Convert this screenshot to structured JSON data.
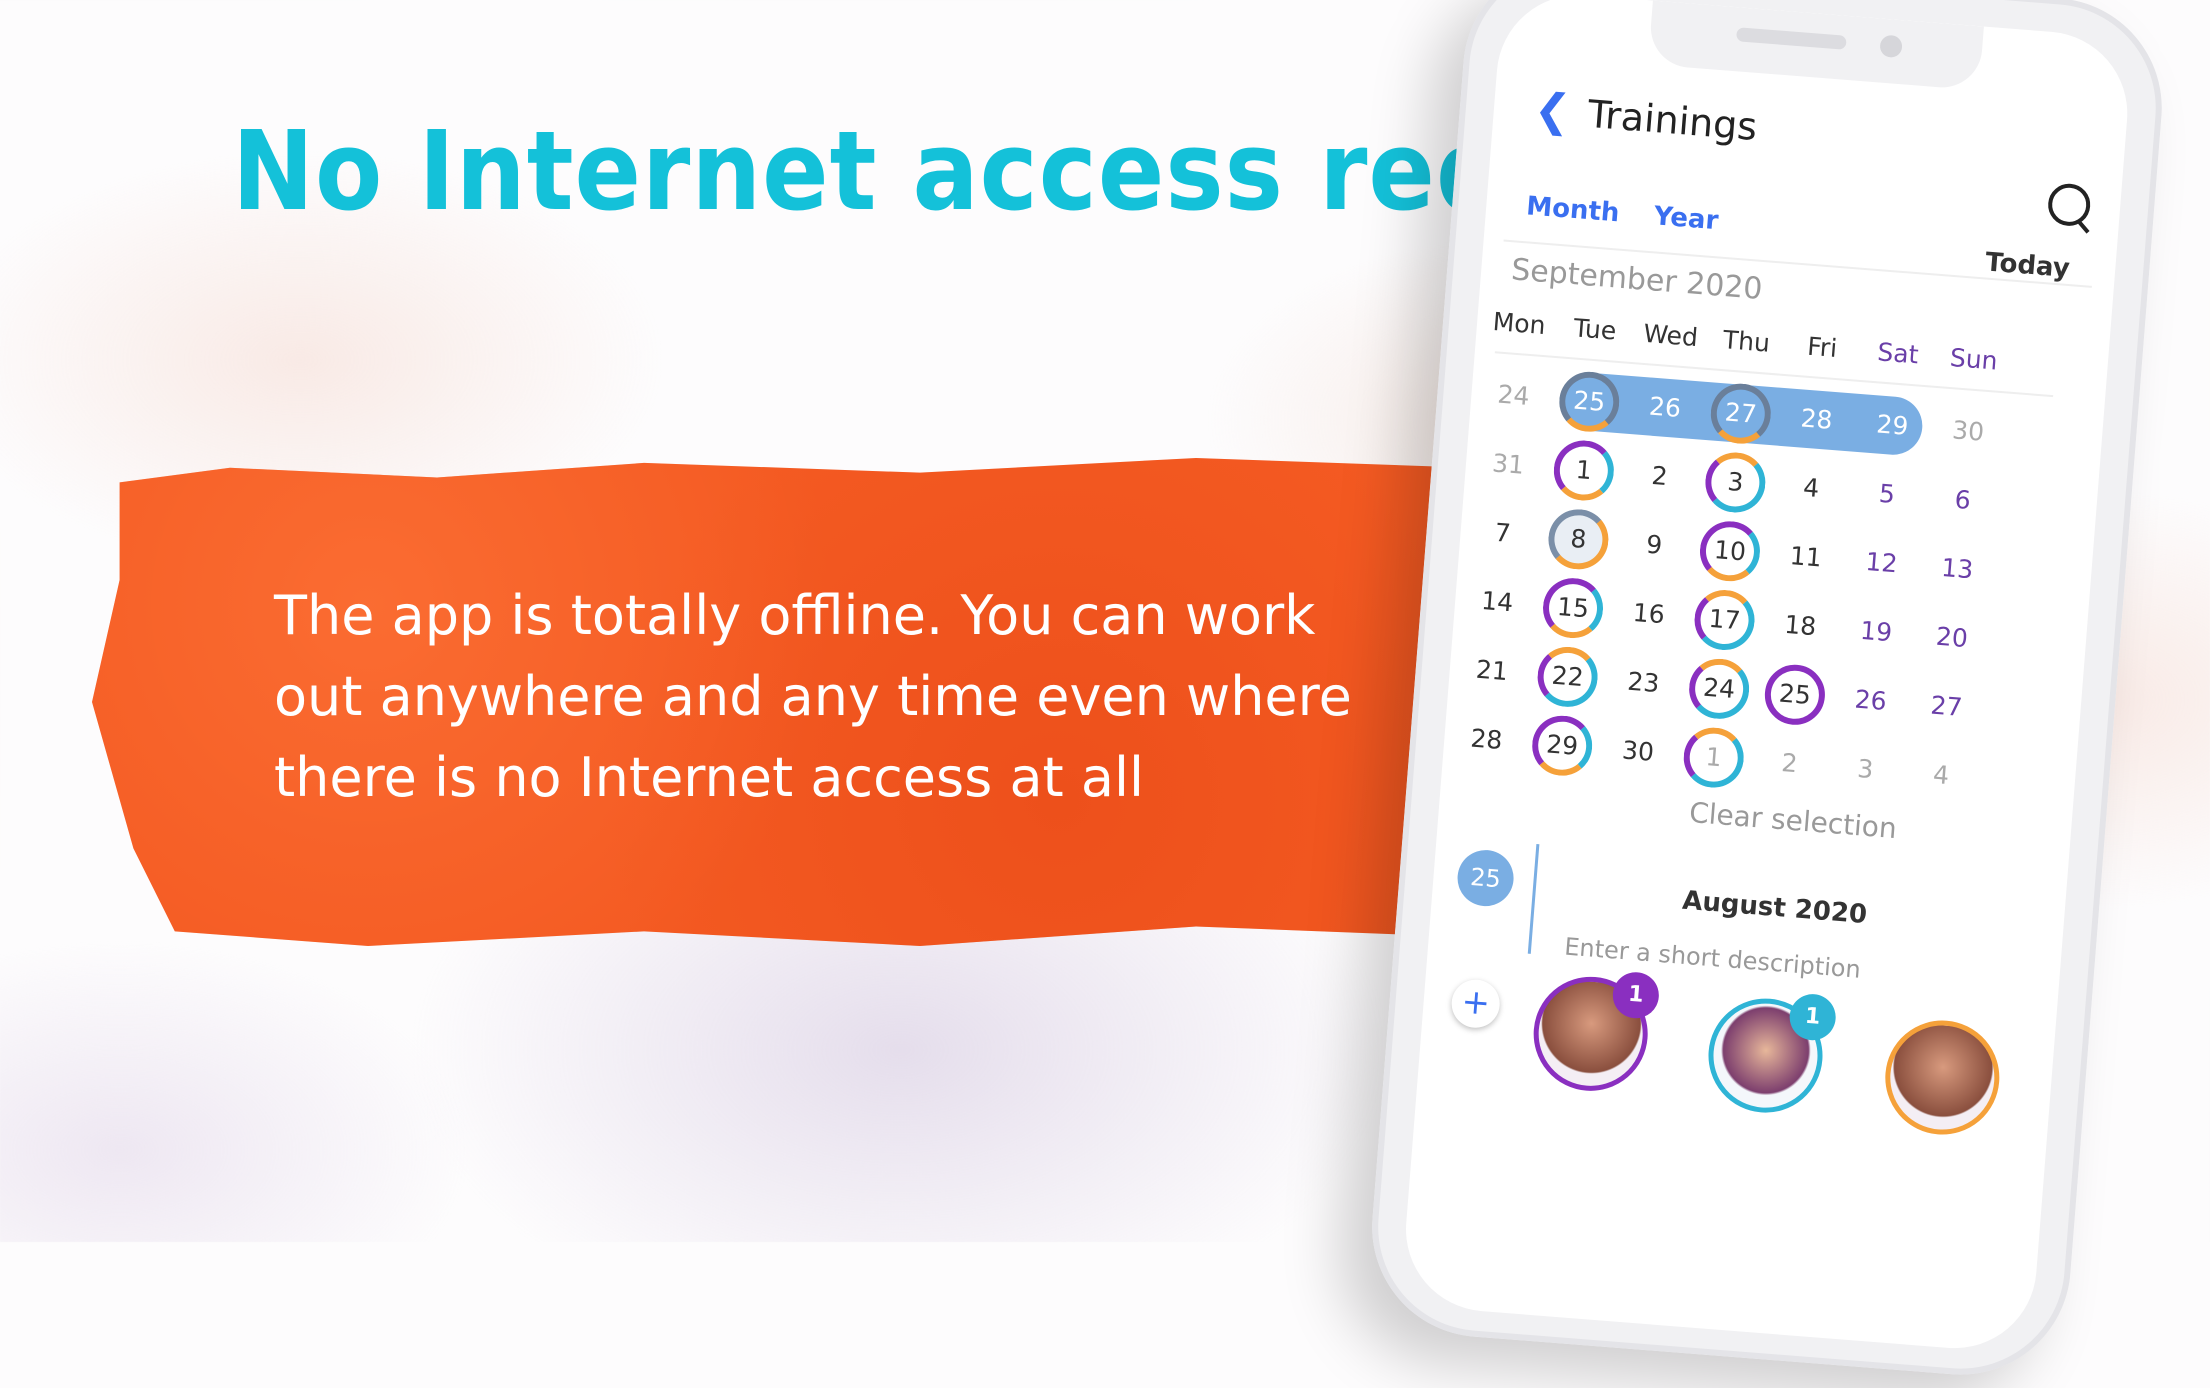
{
  "headline": "No Internet access required",
  "blurb": "The app is totally offline. You can work out anywhere and any time even where there is no Internet access at all",
  "app": {
    "back_icon": "chevron-left-icon",
    "title": "Trainings",
    "search_icon": "search-icon",
    "tabs": [
      "Month",
      "Year"
    ],
    "today_label": "Today",
    "month_label": "September 2020",
    "weekdays": [
      "Mon",
      "Tue",
      "Wed",
      "Thu",
      "Fri",
      "Sat",
      "Sun"
    ],
    "weeks": [
      [
        "24",
        "25",
        "26",
        "27",
        "28",
        "29",
        "30"
      ],
      [
        "31",
        "1",
        "2",
        "3",
        "4",
        "5",
        "6"
      ],
      [
        "7",
        "8",
        "9",
        "10",
        "11",
        "12",
        "13"
      ],
      [
        "14",
        "15",
        "16",
        "17",
        "18",
        "19",
        "20"
      ],
      [
        "21",
        "22",
        "23",
        "24",
        "25",
        "26",
        "27"
      ],
      [
        "28",
        "29",
        "30",
        "1",
        "2",
        "3",
        "4"
      ]
    ],
    "clear_selection": "Clear selection",
    "selected_day": "25",
    "entry_month": "August 2020",
    "description_placeholder": "Enter a short description",
    "add_icon": "plus-circle-icon",
    "exercises": [
      {
        "count": "1",
        "icon": "chest-workout-icon"
      },
      {
        "count": "1",
        "icon": "shoulder-workout-icon"
      },
      {
        "count": "",
        "icon": "abs-workout-icon"
      }
    ],
    "colors": {
      "accent": "#3a6ff0",
      "selection": "#7aaee3",
      "orange": "#f45a22",
      "cyan": "#14c1d9",
      "purple": "#8a2fc0"
    }
  }
}
